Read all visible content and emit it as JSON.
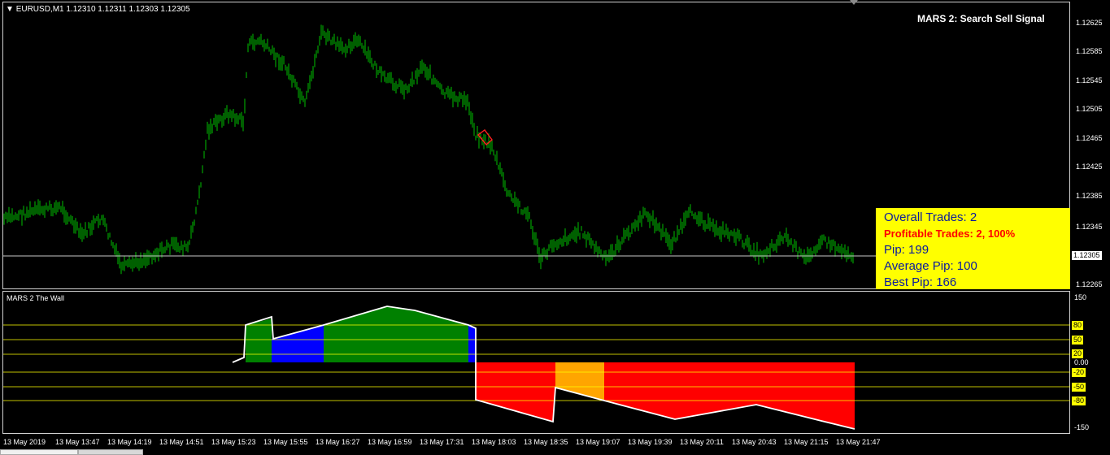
{
  "chart": {
    "symbol_header": "EURUSD,M1  1.12310 1.12311 1.12303 1.12305",
    "signal_text": "MARS 2: Search Sell Signal",
    "price_axis": [
      "1.12625",
      "1.12585",
      "1.12545",
      "1.12505",
      "1.12465",
      "1.12425",
      "1.12385",
      "1.12345",
      "1.12265"
    ],
    "current_price": "1.12305"
  },
  "stats": {
    "overall_trades": "Overall Trades: 2",
    "profitable_trades": "Profitable Trades: 2, 100%",
    "pip": "Pip: 199",
    "average_pip": "Average Pip: 100",
    "best_pip": "Best Pip: 166"
  },
  "indicator": {
    "title": "MARS 2 The Wall",
    "axis": {
      "top": "150",
      "zero": "0.00",
      "bottom": "-150"
    },
    "levels": [
      "80",
      "50",
      "20",
      "-20",
      "-50",
      "-80"
    ]
  },
  "time_axis": [
    "13 May 2019",
    "13 May 13:47",
    "13 May 14:19",
    "13 May 14:51",
    "13 May 15:23",
    "13 May 15:55",
    "13 May 16:27",
    "13 May 16:59",
    "13 May 17:31",
    "13 May 18:03",
    "13 May 18:35",
    "13 May 19:07",
    "13 May 19:39",
    "13 May 20:11",
    "13 May 20:43",
    "13 May 21:15",
    "13 May 21:47"
  ],
  "colors": {
    "candles": "#00c000",
    "bull_zone": "#008000",
    "bull_soft": "#0000ff",
    "bear_zone": "#ff0000",
    "bear_soft": "#ffa500",
    "level_line": "#ffff00",
    "panel": "#ffff00"
  }
}
